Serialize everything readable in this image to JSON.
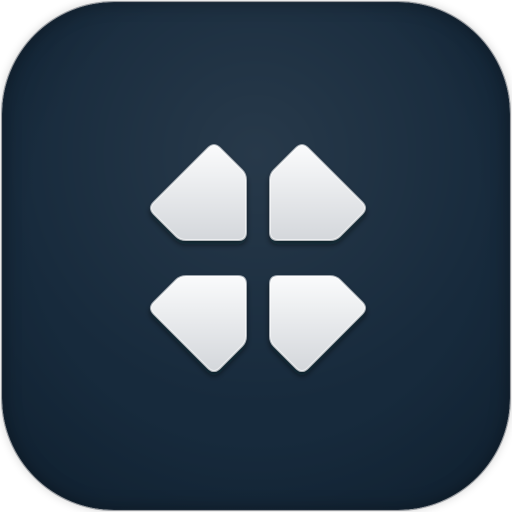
{
  "icon": {
    "name": "collapse-arrows-icon",
    "style": "app-tile"
  },
  "colors": {
    "tile_bg": "#172a3c",
    "tile_bg_edge": "#0f1f2e",
    "glyph_light": "#f2f3f5",
    "glyph_mid": "#d6d8dc",
    "glyph_shadow": "#0a1119"
  }
}
